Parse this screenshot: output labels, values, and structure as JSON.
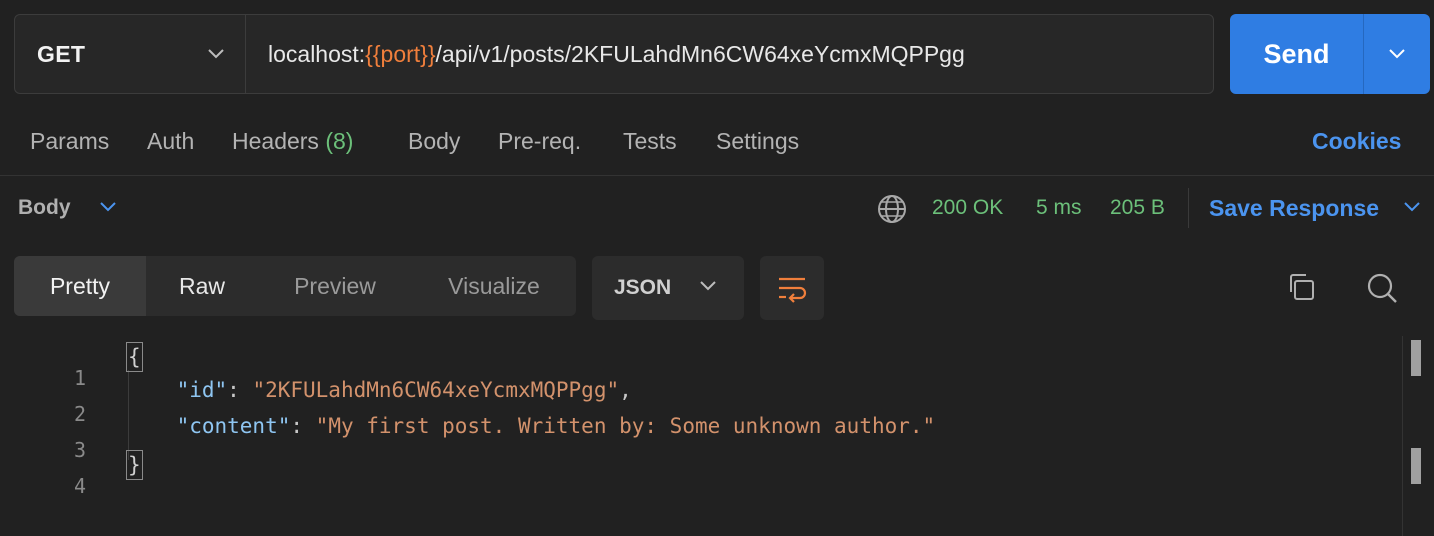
{
  "request": {
    "method": "GET",
    "url_prefix": "localhost:",
    "url_variable": "{{port}}",
    "url_suffix": "/api/v1/posts/2KFULahdMn6CW64xeYcmxMQPPgg",
    "send_label": "Send"
  },
  "tabs": [
    {
      "label": "Params"
    },
    {
      "label": "Auth"
    },
    {
      "label": "Headers",
      "count": "(8)"
    },
    {
      "label": "Body"
    },
    {
      "label": "Pre-req."
    },
    {
      "label": "Tests"
    },
    {
      "label": "Settings"
    }
  ],
  "cookies_label": "Cookies",
  "response": {
    "title": "Body",
    "status": "200 OK",
    "time": "5 ms",
    "size": "205 B",
    "save_label": "Save Response"
  },
  "views": [
    {
      "label": "Pretty"
    },
    {
      "label": "Raw"
    },
    {
      "label": "Preview"
    },
    {
      "label": "Visualize"
    }
  ],
  "format": "JSON",
  "code": {
    "line_numbers": [
      "1",
      "2",
      "3",
      "4"
    ],
    "open_brace": "{",
    "close_brace": "}",
    "id_key": "\"id\"",
    "id_value": "\"2KFULahdMn6CW64xeYcmxMQPPgg\"",
    "content_key": "\"content\"",
    "content_value": "\"My first post. Written by: Some unknown author.\""
  },
  "colors": {
    "accent": "#2f7de3",
    "link": "#4b94ef",
    "success": "#6cc07a",
    "variable": "#f07f3c",
    "json_key": "#8fc6f2",
    "json_string": "#d3926c"
  },
  "icons": [
    "chevron-down-icon",
    "globe-icon",
    "wrap-lines-icon",
    "copy-icon",
    "search-icon"
  ]
}
